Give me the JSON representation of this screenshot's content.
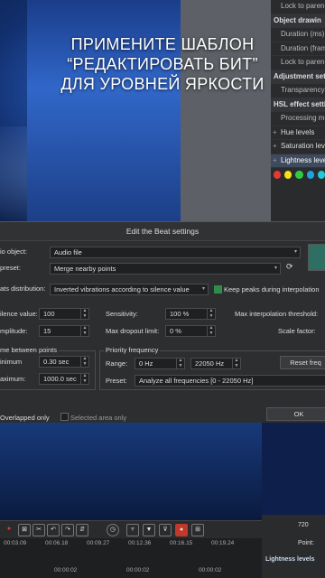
{
  "overlay": {
    "line1": "ПРИМЕНИТЕ ШАБЛОН",
    "line2": "“РЕДАКТИРОВАТЬ БИТ”",
    "line3": "ДЛЯ УРОВНЕЙ ЯРКОСТИ"
  },
  "right_panel": {
    "rows": [
      {
        "label": "Lock to paren",
        "kind": "item"
      },
      {
        "label": "Object drawin",
        "kind": "hdr"
      },
      {
        "label": "Duration (ms)",
        "kind": "item"
      },
      {
        "label": "Duration (fram",
        "kind": "item"
      },
      {
        "label": "Lock to paren",
        "kind": "item"
      },
      {
        "label": "Adjustment setti",
        "kind": "hdr"
      },
      {
        "label": "Transparency",
        "kind": "item"
      },
      {
        "label": "HSL effect setti",
        "kind": "hdr"
      },
      {
        "label": "Processing mode",
        "kind": "item"
      },
      {
        "label": "Hue levels",
        "kind": "lvl"
      },
      {
        "label": "Saturation levels",
        "kind": "lvl"
      },
      {
        "label": "Lightness levels",
        "kind": "hl"
      }
    ],
    "dot_colors": [
      "#e53935",
      "#f5e11a",
      "#2ecc40",
      "#1fa2e0",
      "#22c8d6"
    ]
  },
  "dialog": {
    "title": "Edit the Beat settings",
    "audio_object_label": "io object:",
    "audio_object_value": "Audio file",
    "preset_label": "preset:",
    "preset_value": "Merge nearby points",
    "beats_distribution_label": "ats distribution:",
    "beats_distribution_value": "Inverted vibrations according to silence value",
    "keep_peaks_label": "Keep peaks during interpolation",
    "silence_label": "ilence value:",
    "silence_value": "100",
    "amplitude_label": "mplitude:",
    "amplitude_value": "15",
    "sensitivity_label": "Sensitivity:",
    "sensitivity_value": "100 %",
    "dropout_label": "Max dropout limit:",
    "dropout_value": "0 %",
    "interp_label": "Max interpolation threshold:",
    "scale_label": "Scale factor:",
    "time_group_label": "me between points",
    "minimum_label": "inimum",
    "minimum_value": "0.30 sec",
    "maximum_label": "aximum:",
    "maximum_value": "1000.0 sec",
    "priority_group_label": "Priority frequency",
    "range_label": "Range:",
    "range_from": "0 Hz",
    "range_to": "22050 Hz",
    "reset_label": "Reset freq",
    "preset2_label": "Preset:",
    "preset2_value": "Analyze all frequencies [0 - 22050 Hz]",
    "overlapped_label": "Overlapped only",
    "selected_area_label": "Selected area only",
    "ok_label": "OK"
  },
  "timeline": {
    "ruler_ticks": [
      "00:03.09",
      "00:06.18",
      "00:09.27",
      "00:12.36",
      "00:16.15",
      "00:19.24"
    ],
    "ruler_bottom": [
      "00:00:02",
      "00:00:02",
      "00:00:02"
    ],
    "zoom_label": "720",
    "point_label": "Point:",
    "lightness_label": "Lightness levels"
  }
}
